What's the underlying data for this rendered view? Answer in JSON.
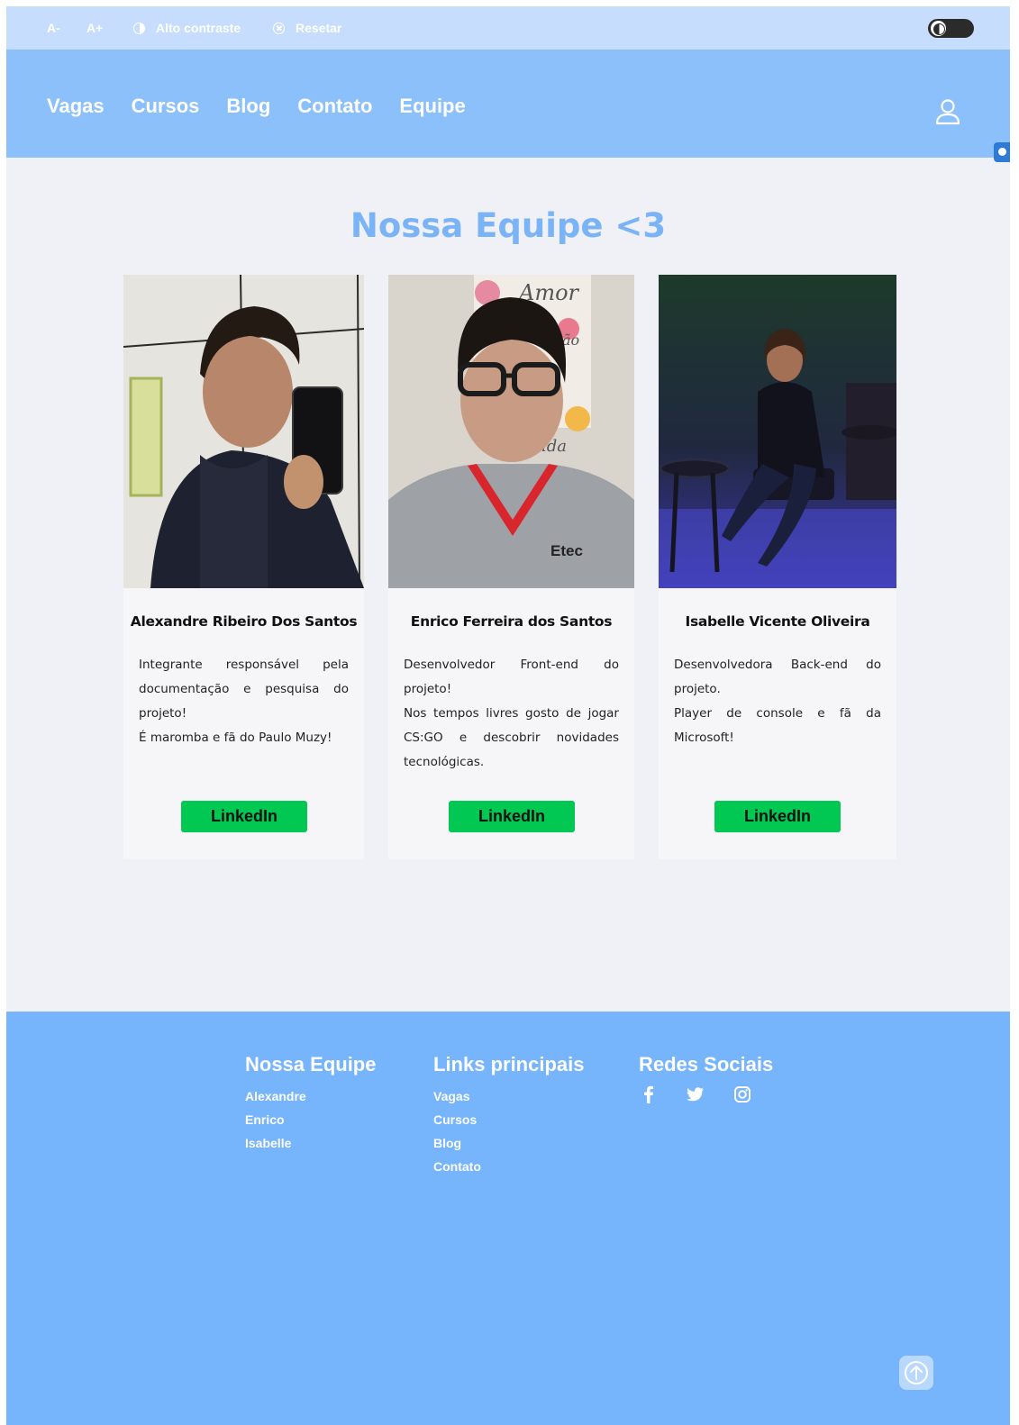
{
  "accessibility_bar": {
    "font_decrease": "A-",
    "font_increase": "A+",
    "high_contrast": "Alto contraste",
    "reset": "Resetar"
  },
  "nav": {
    "items": [
      "Vagas",
      "Cursos",
      "Blog",
      "Contato",
      "Equipe"
    ]
  },
  "team": {
    "title": "Nossa Equipe <3",
    "members": [
      {
        "name": "Alexandre Ribeiro Dos Santos",
        "description": [
          "Integrante responsável pela documentação e pesquisa do projeto!",
          "É maromba e fã do Paulo Muzy!"
        ],
        "button": "LinkedIn"
      },
      {
        "name": "Enrico Ferreira dos Santos",
        "description": [
          "Desenvolvedor Front-end do projeto!",
          "Nos tempos livres gosto de jogar CS:GO e descobrir novidades tecnológicas."
        ],
        "button": "LinkedIn",
        "photo_text": {
          "poster_top": "Amor",
          "poster_mid": "ão",
          "poster_bottom": "ida",
          "shirt_logo": "Etec"
        }
      },
      {
        "name": "Isabelle Vicente Oliveira",
        "description": [
          "Desenvolvedora Back-end do projeto.",
          "Player de console e fã da Microsoft!"
        ],
        "button": "LinkedIn"
      }
    ]
  },
  "footer": {
    "team_heading": "Nossa Equipe",
    "team_links": [
      "Alexandre",
      "Enrico",
      "Isabelle"
    ],
    "links_heading": "Links principais",
    "main_links": [
      "Vagas",
      "Cursos",
      "Blog",
      "Contato"
    ],
    "social_heading": "Redes Sociais",
    "social_icons": [
      "facebook-icon",
      "twitter-icon",
      "instagram-icon"
    ]
  },
  "colors": {
    "accessibility_bar": "#c6ddfd",
    "header": "#8cc0fa",
    "page_background": "#eff1f7",
    "title": "#7ab4f6",
    "linkedin_button": "#00c853",
    "footer": "#76b4fc"
  }
}
